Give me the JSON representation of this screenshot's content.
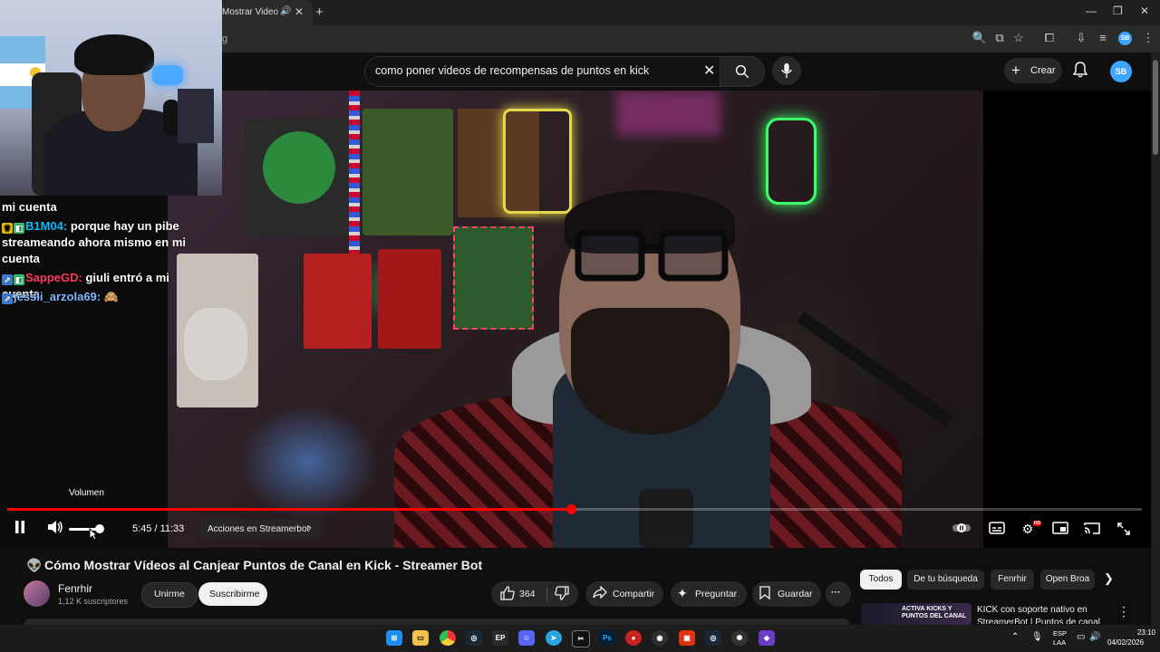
{
  "browser": {
    "tab_title": "Mostrar Videos al",
    "tab_audio_icon": "speaker-icon",
    "tab_close": "✕",
    "new_tab": "+",
    "url_fragment": "g",
    "window": {
      "minimize": "—",
      "maximize": "❐",
      "close": "✕"
    }
  },
  "header": {
    "search_query": "como poner videos de recompensas de puntos en kick",
    "clear": "✕",
    "search_icon": "search-icon",
    "mic_icon": "mic-icon",
    "create_label": "Crear",
    "create_plus": "+",
    "bell_icon": "bell-icon",
    "avatar_text": "SB"
  },
  "chat": [
    {
      "user": "",
      "text": "mi cuenta",
      "color": "#ffffff"
    },
    {
      "user": "B1M04:",
      "text": " porque hay un pibe streameando ahora mismo en mi cuenta",
      "color": "#00bfff"
    },
    {
      "user": "SappeGD:",
      "text": " giuli entró a mi cuenta",
      "color": "#ff3b5c"
    },
    {
      "user": "jessii_arzola69:",
      "text": " 🙈",
      "color": "#7fb8ff"
    }
  ],
  "player": {
    "volume_tooltip": "Volumen",
    "time": "5:45 / 11:33",
    "progress_fraction": 0.497,
    "volume_level": 0.85,
    "chapter": "Acciones en Streamerbot",
    "chapter_arrow": "›",
    "hd_badge": "HD"
  },
  "video": {
    "title": "Cómo Mostrar Vídeos al Canjear Puntos de Canal en Kick - Streamer Bot",
    "channel": "Fenrhir",
    "subscribers": "1,12 K suscriptores",
    "join_label": "Unirme",
    "subscribe_label": "Suscribirme",
    "likes": "364",
    "share_label": "Compartir",
    "ask_label": "Preguntar",
    "save_label": "Guardar",
    "more": "···"
  },
  "sidebar": {
    "chips": [
      "Todos",
      "De tu búsqueda",
      "Fenrhir",
      "Open Broa"
    ],
    "rec_thumb_text": "ACTIVA KICKS Y PUNTOS DEL CANAL",
    "rec_title": "KICK con soporte nativo en StreamerBot | Puntos de canal"
  },
  "taskbar": {
    "lang1": "ESP",
    "lang2": "LAA",
    "time": "23:10",
    "date": "04/02/2026",
    "icons": [
      "windows-start-icon",
      "file-explorer-icon",
      "chrome-icon",
      "steam-icon",
      "epic-icon",
      "discord-icon",
      "telegram-icon",
      "capcut-icon",
      "photoshop-icon",
      "record-icon",
      "obs-icon",
      "app-red-icon",
      "steam-2-icon",
      "openai-icon",
      "streamerbot-icon"
    ]
  }
}
